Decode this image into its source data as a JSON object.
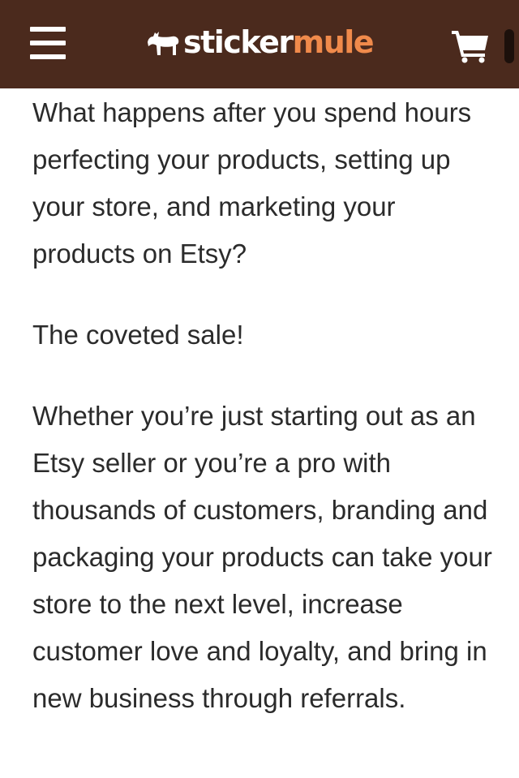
{
  "header": {
    "menu_icon": "hamburger-menu-icon",
    "logo": {
      "icon": "mule-icon",
      "word_part1": "sticker",
      "word_part2": "mule"
    },
    "cart_icon": "shopping-cart-icon",
    "colors": {
      "background": "#4b2a1d",
      "logo_accent": "#f08a4b"
    }
  },
  "article": {
    "paragraphs": [
      "What happens after you spend hours perfecting your products, setting up your store, and marketing your products on Etsy?",
      "The coveted sale!",
      "Whether you’re just starting out as an Etsy seller or you’re a pro with thousands of customers, branding and packaging your products can take your store to the next level, increase customer love and loyalty, and bring in new business through referrals."
    ]
  }
}
